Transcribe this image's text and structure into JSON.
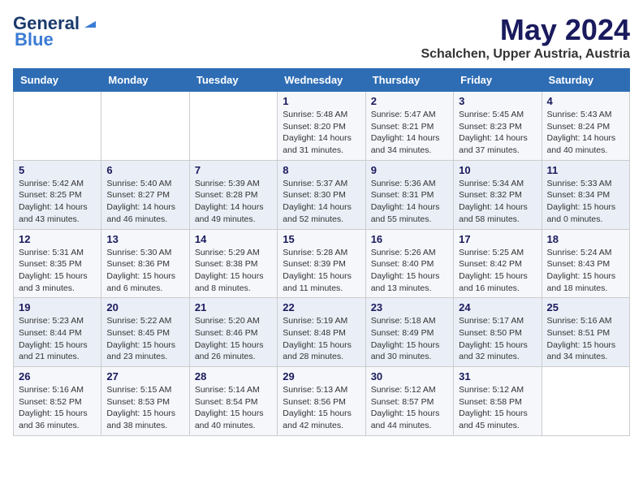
{
  "header": {
    "logo_line1": "General",
    "logo_line2": "Blue",
    "title": "May 2024",
    "subtitle": "Schalchen, Upper Austria, Austria"
  },
  "weekdays": [
    "Sunday",
    "Monday",
    "Tuesday",
    "Wednesday",
    "Thursday",
    "Friday",
    "Saturday"
  ],
  "weeks": [
    [
      {
        "day": "",
        "info": ""
      },
      {
        "day": "",
        "info": ""
      },
      {
        "day": "",
        "info": ""
      },
      {
        "day": "1",
        "info": "Sunrise: 5:48 AM\nSunset: 8:20 PM\nDaylight: 14 hours\nand 31 minutes."
      },
      {
        "day": "2",
        "info": "Sunrise: 5:47 AM\nSunset: 8:21 PM\nDaylight: 14 hours\nand 34 minutes."
      },
      {
        "day": "3",
        "info": "Sunrise: 5:45 AM\nSunset: 8:23 PM\nDaylight: 14 hours\nand 37 minutes."
      },
      {
        "day": "4",
        "info": "Sunrise: 5:43 AM\nSunset: 8:24 PM\nDaylight: 14 hours\nand 40 minutes."
      }
    ],
    [
      {
        "day": "5",
        "info": "Sunrise: 5:42 AM\nSunset: 8:25 PM\nDaylight: 14 hours\nand 43 minutes."
      },
      {
        "day": "6",
        "info": "Sunrise: 5:40 AM\nSunset: 8:27 PM\nDaylight: 14 hours\nand 46 minutes."
      },
      {
        "day": "7",
        "info": "Sunrise: 5:39 AM\nSunset: 8:28 PM\nDaylight: 14 hours\nand 49 minutes."
      },
      {
        "day": "8",
        "info": "Sunrise: 5:37 AM\nSunset: 8:30 PM\nDaylight: 14 hours\nand 52 minutes."
      },
      {
        "day": "9",
        "info": "Sunrise: 5:36 AM\nSunset: 8:31 PM\nDaylight: 14 hours\nand 55 minutes."
      },
      {
        "day": "10",
        "info": "Sunrise: 5:34 AM\nSunset: 8:32 PM\nDaylight: 14 hours\nand 58 minutes."
      },
      {
        "day": "11",
        "info": "Sunrise: 5:33 AM\nSunset: 8:34 PM\nDaylight: 15 hours\nand 0 minutes."
      }
    ],
    [
      {
        "day": "12",
        "info": "Sunrise: 5:31 AM\nSunset: 8:35 PM\nDaylight: 15 hours\nand 3 minutes."
      },
      {
        "day": "13",
        "info": "Sunrise: 5:30 AM\nSunset: 8:36 PM\nDaylight: 15 hours\nand 6 minutes."
      },
      {
        "day": "14",
        "info": "Sunrise: 5:29 AM\nSunset: 8:38 PM\nDaylight: 15 hours\nand 8 minutes."
      },
      {
        "day": "15",
        "info": "Sunrise: 5:28 AM\nSunset: 8:39 PM\nDaylight: 15 hours\nand 11 minutes."
      },
      {
        "day": "16",
        "info": "Sunrise: 5:26 AM\nSunset: 8:40 PM\nDaylight: 15 hours\nand 13 minutes."
      },
      {
        "day": "17",
        "info": "Sunrise: 5:25 AM\nSunset: 8:42 PM\nDaylight: 15 hours\nand 16 minutes."
      },
      {
        "day": "18",
        "info": "Sunrise: 5:24 AM\nSunset: 8:43 PM\nDaylight: 15 hours\nand 18 minutes."
      }
    ],
    [
      {
        "day": "19",
        "info": "Sunrise: 5:23 AM\nSunset: 8:44 PM\nDaylight: 15 hours\nand 21 minutes."
      },
      {
        "day": "20",
        "info": "Sunrise: 5:22 AM\nSunset: 8:45 PM\nDaylight: 15 hours\nand 23 minutes."
      },
      {
        "day": "21",
        "info": "Sunrise: 5:20 AM\nSunset: 8:46 PM\nDaylight: 15 hours\nand 26 minutes."
      },
      {
        "day": "22",
        "info": "Sunrise: 5:19 AM\nSunset: 8:48 PM\nDaylight: 15 hours\nand 28 minutes."
      },
      {
        "day": "23",
        "info": "Sunrise: 5:18 AM\nSunset: 8:49 PM\nDaylight: 15 hours\nand 30 minutes."
      },
      {
        "day": "24",
        "info": "Sunrise: 5:17 AM\nSunset: 8:50 PM\nDaylight: 15 hours\nand 32 minutes."
      },
      {
        "day": "25",
        "info": "Sunrise: 5:16 AM\nSunset: 8:51 PM\nDaylight: 15 hours\nand 34 minutes."
      }
    ],
    [
      {
        "day": "26",
        "info": "Sunrise: 5:16 AM\nSunset: 8:52 PM\nDaylight: 15 hours\nand 36 minutes."
      },
      {
        "day": "27",
        "info": "Sunrise: 5:15 AM\nSunset: 8:53 PM\nDaylight: 15 hours\nand 38 minutes."
      },
      {
        "day": "28",
        "info": "Sunrise: 5:14 AM\nSunset: 8:54 PM\nDaylight: 15 hours\nand 40 minutes."
      },
      {
        "day": "29",
        "info": "Sunrise: 5:13 AM\nSunset: 8:56 PM\nDaylight: 15 hours\nand 42 minutes."
      },
      {
        "day": "30",
        "info": "Sunrise: 5:12 AM\nSunset: 8:57 PM\nDaylight: 15 hours\nand 44 minutes."
      },
      {
        "day": "31",
        "info": "Sunrise: 5:12 AM\nSunset: 8:58 PM\nDaylight: 15 hours\nand 45 minutes."
      },
      {
        "day": "",
        "info": ""
      }
    ]
  ]
}
